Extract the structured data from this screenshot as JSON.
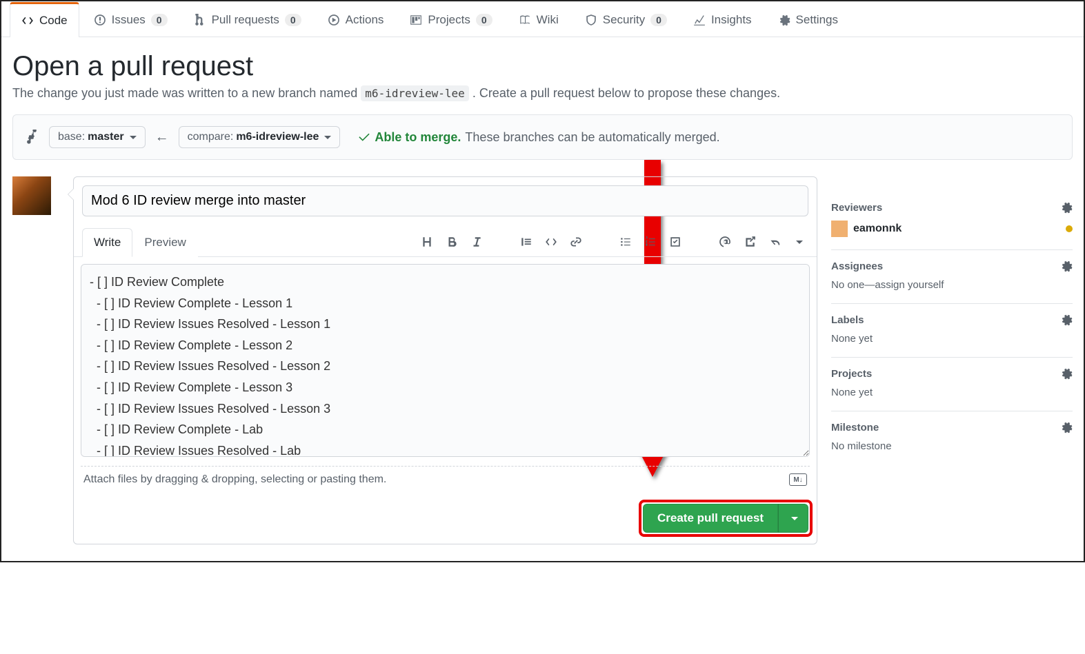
{
  "nav": {
    "code": "Code",
    "issues": "Issues",
    "issues_count": "0",
    "prs": "Pull requests",
    "prs_count": "0",
    "actions": "Actions",
    "projects": "Projects",
    "projects_count": "0",
    "wiki": "Wiki",
    "security": "Security",
    "security_count": "0",
    "insights": "Insights",
    "settings": "Settings"
  },
  "header": {
    "title": "Open a pull request",
    "subtitle_pre": "The change you just made was written to a new branch named ",
    "branch": "m6-idreview-lee",
    "subtitle_post": " . Create a pull request below to propose these changes."
  },
  "range": {
    "base_label": "base: ",
    "base_value": "master",
    "compare_label": "compare: ",
    "compare_value": "m6-idreview-lee",
    "able": "Able to merge.",
    "able_desc": "These branches can be automatically merged."
  },
  "form": {
    "title_value": "Mod 6 ID review merge into master",
    "tab_write": "Write",
    "tab_preview": "Preview",
    "body_value": "- [ ] ID Review Complete\n  - [ ] ID Review Complete - Lesson 1\n  - [ ] ID Review Issues Resolved - Lesson 1\n  - [ ] ID Review Complete - Lesson 2\n  - [ ] ID Review Issues Resolved - Lesson 2\n  - [ ] ID Review Complete - Lesson 3\n  - [ ] ID Review Issues Resolved - Lesson 3\n  - [ ] ID Review Complete - Lab\n  - [ ] ID Review Issues Resolved - Lab",
    "drag_hint": "Attach files by dragging & dropping, selecting or pasting them.",
    "md_badge": "M↓",
    "submit": "Create pull request"
  },
  "sidebar": {
    "reviewers_h": "Reviewers",
    "reviewer_name": "eamonnk",
    "assignees_h": "Assignees",
    "assignees_v": "No one—assign yourself",
    "labels_h": "Labels",
    "labels_v": "None yet",
    "projects_h": "Projects",
    "projects_v": "None yet",
    "milestone_h": "Milestone",
    "milestone_v": "No milestone"
  }
}
